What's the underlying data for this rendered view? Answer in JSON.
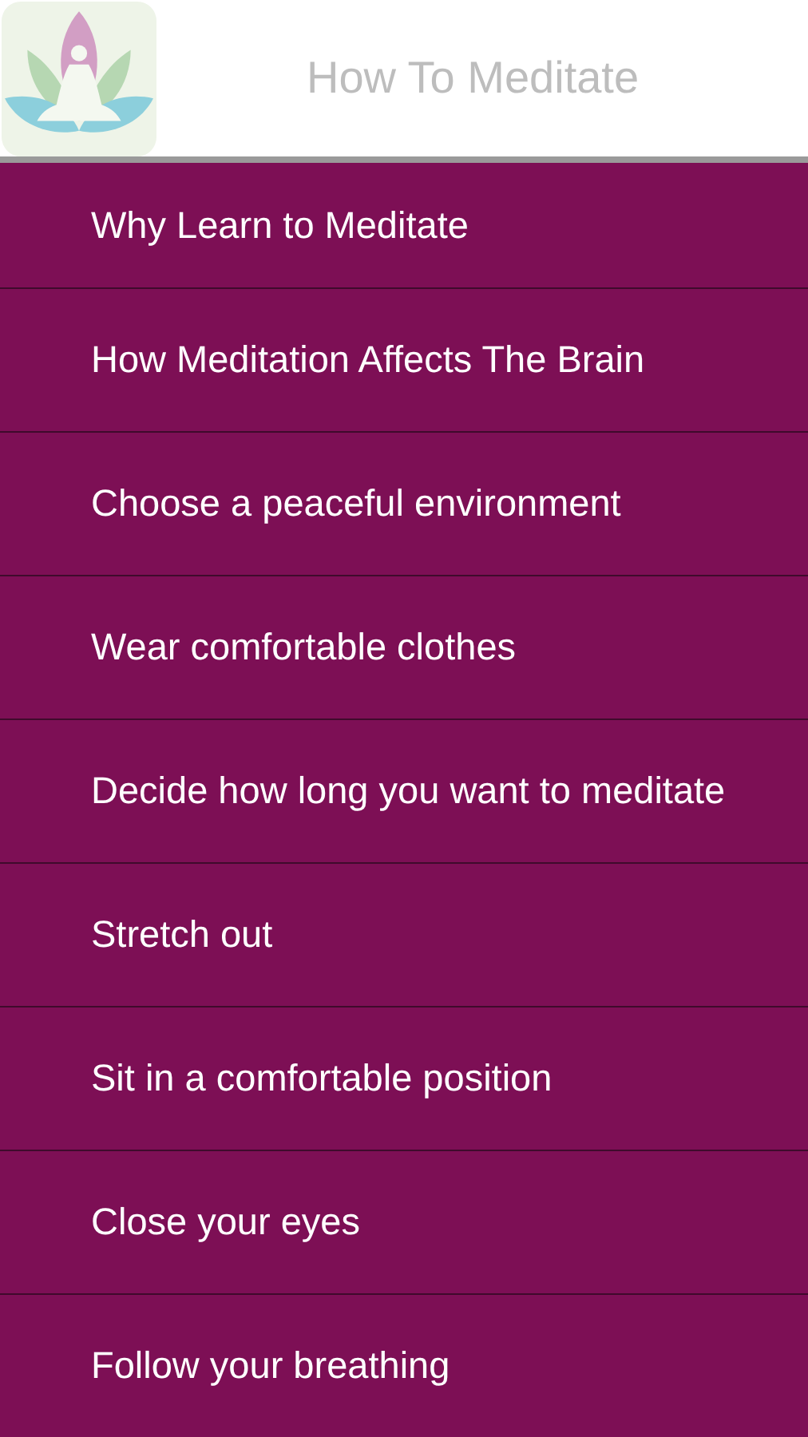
{
  "header": {
    "title": "How To Meditate"
  },
  "items": [
    "Why Learn to Meditate",
    "How Meditation Affects The Brain",
    "Choose a peaceful environment",
    "Wear comfortable clothes",
    "Decide how long you want to meditate",
    "Stretch out",
    "Sit in a comfortable position",
    "Close your eyes",
    "Follow your breathing"
  ]
}
